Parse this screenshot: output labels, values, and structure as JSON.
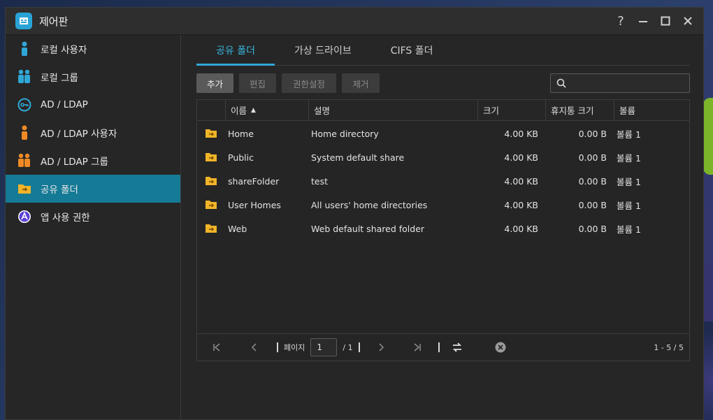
{
  "window": {
    "title": "제어판"
  },
  "sidebar": {
    "items": [
      {
        "label": "로컬 사용자",
        "icon": "user-icon",
        "active": false
      },
      {
        "label": "로컬 그룹",
        "icon": "group-icon",
        "active": false
      },
      {
        "label": "AD / LDAP",
        "icon": "key-icon",
        "active": false
      },
      {
        "label": "AD / LDAP 사용자",
        "icon": "user-icon",
        "active": false
      },
      {
        "label": "AD / LDAP 그룹",
        "icon": "group-icon",
        "active": false
      },
      {
        "label": "공유 폴더",
        "icon": "folder-icon",
        "active": true
      },
      {
        "label": "앱 사용 권한",
        "icon": "app-permission-icon",
        "active": false
      }
    ]
  },
  "tabs": [
    {
      "label": "공유 폴더",
      "active": true
    },
    {
      "label": "가상 드라이브",
      "active": false
    },
    {
      "label": "CIFS 폴더",
      "active": false
    }
  ],
  "toolbar": {
    "add": "추가",
    "edit": "편집",
    "permissions": "권한설정",
    "remove": "제거",
    "search_placeholder": ""
  },
  "table": {
    "columns": {
      "name": "이름",
      "description": "설명",
      "size": "크기",
      "trash_size": "휴지통 크기",
      "volume": "볼륨"
    },
    "rows": [
      {
        "name": "Home",
        "description": "Home directory",
        "size": "4.00 KB",
        "trash_size": "0.00 B",
        "volume": "볼륨 1"
      },
      {
        "name": "Public",
        "description": "System default share",
        "size": "4.00 KB",
        "trash_size": "0.00 B",
        "volume": "볼륨 1"
      },
      {
        "name": "shareFolder",
        "description": "test",
        "size": "4.00 KB",
        "trash_size": "0.00 B",
        "volume": "볼륨 1"
      },
      {
        "name": "User Homes",
        "description": "All users' home directories",
        "size": "4.00 KB",
        "trash_size": "0.00 B",
        "volume": "볼륨 1"
      },
      {
        "name": "Web",
        "description": "Web default shared folder",
        "size": "4.00 KB",
        "trash_size": "0.00 B",
        "volume": "볼륨 1"
      }
    ]
  },
  "pager": {
    "page_label": "페이지",
    "page_value": "1",
    "total_pages": "/ 1",
    "range": "1 - 5 / 5"
  },
  "colors": {
    "accent": "#2fa8d8",
    "active_item": "#157a96",
    "folder": "#f0b429"
  }
}
